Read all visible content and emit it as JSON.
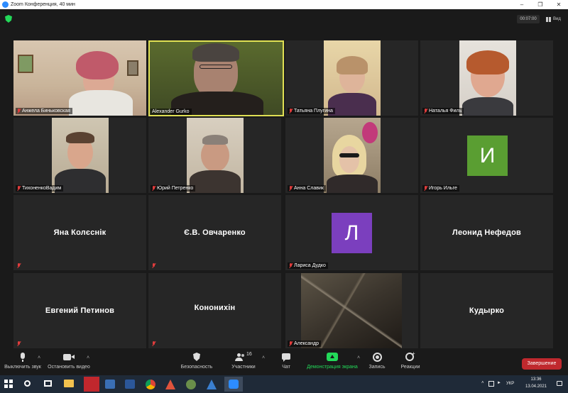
{
  "window": {
    "title": "Zoom Конференция, 40 мин",
    "timer": "00:07:00",
    "view_label": "Вид"
  },
  "participants": [
    {
      "name": "Анжела Биньковская"
    },
    {
      "name": "Alexander Gurko"
    },
    {
      "name": "Татьяна Плугина"
    },
    {
      "name": "Наталья Филь"
    },
    {
      "name": "ТихоненкоВадим"
    },
    {
      "name": "Юрий Петренко"
    },
    {
      "name": "Анна Славик"
    },
    {
      "name": "Игорь Ильге",
      "avatar_letter": "И",
      "avatar_color": "#5a9e32"
    },
    {
      "name": "Яна Колєснік"
    },
    {
      "name": "Є.В. Овчаренко"
    },
    {
      "name": "Лариса Дудко",
      "avatar_letter": "Л",
      "avatar_color": "#7b3fbe"
    },
    {
      "name": "Леонид Нефедов"
    },
    {
      "name": "Евгений Петинов"
    },
    {
      "name": "Кононихін"
    },
    {
      "name": "Александр"
    },
    {
      "name": "Кудырко"
    }
  ],
  "toolbar": {
    "mute": "Выключить звук",
    "stop_video": "Остановить видео",
    "security": "Безопасность",
    "participants": "Участники",
    "participants_count": "16",
    "chat": "Чат",
    "share": "Демонстрация экрана",
    "record": "Запись",
    "reactions": "Реакции",
    "end": "Завершение"
  },
  "taskbar": {
    "lang": "УКР",
    "time": "13:36",
    "date": "13.04.2021"
  },
  "colors": {
    "share_green": "#23d959",
    "end_red": "#c0292e",
    "active_speaker": "#e0e054"
  }
}
